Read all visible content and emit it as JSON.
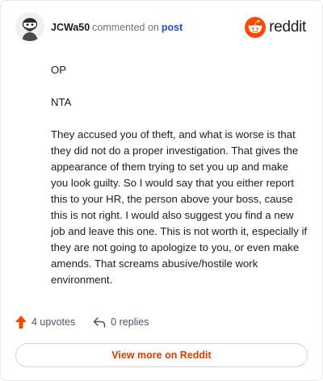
{
  "header": {
    "username": "JCWa50",
    "action_text": "commented on",
    "post_link": "post",
    "brand": "reddit"
  },
  "comment": {
    "paragraphs": [
      "OP",
      "NTA",
      "They accused you of theft, and what is worse is that they did not do a proper investigation. That gives the appearance of them trying to set you up and make you look guilty. So I would say that you either report this to your HR, the person above your boss, cause this is not right. I would also suggest you find a new job and leave this one. This is not worth it, especially if they are not going to apologize to you, or even make amends. That screams abusive/hostile work environment."
    ]
  },
  "footer": {
    "upvotes": "4 upvotes",
    "replies": "0 replies",
    "view_more": "View more on Reddit"
  },
  "colors": {
    "brand": "#ff4500",
    "link": "#1d4ed8",
    "cta_text": "#d93a00"
  },
  "icons": {
    "avatar": "snoo-avatar",
    "logo": "reddit-logo-icon",
    "upvote": "upvote-arrow-icon",
    "reply": "reply-arrow-icon"
  }
}
